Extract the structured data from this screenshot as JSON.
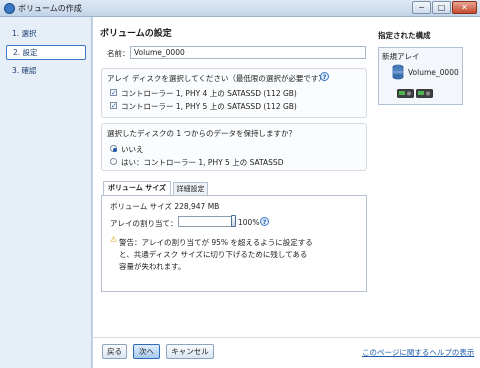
{
  "window": {
    "title": "ボリュームの作成",
    "min": "−",
    "max": "□",
    "close": "✕"
  },
  "steps": [
    {
      "label": "1. 選択"
    },
    {
      "label": "2. 設定"
    },
    {
      "label": "3. 確認"
    }
  ],
  "main": {
    "heading": "ボリュームの設定",
    "name_label": "名前：",
    "name_value": "Volume_0000",
    "disk_prompt": "アレイ ディスクを選択してください（最低限の選択が必要です）：",
    "disks": [
      {
        "label": "コントローラー 1, PHY 4 上の SATASSD (112 GB)",
        "checked": true
      },
      {
        "label": "コントローラー 1, PHY 5 上の SATASSD (112 GB)",
        "checked": true
      }
    ],
    "keep_prompt": "選択したディスクの 1 つからのデータを保持しますか？",
    "keep_options": [
      {
        "label": "いいえ",
        "selected": true
      },
      {
        "label": "はい：コントローラー 1, PHY 5 上の SATASSD",
        "selected": false
      }
    ],
    "tabs": [
      {
        "label": "ボリューム サイズ"
      },
      {
        "label": "詳細設定"
      }
    ],
    "volume_size": "ボリューム サイズ 228,947 MB",
    "alloc_label": "アレイの割り当て：",
    "alloc_percent": "100%",
    "alloc_value": 1.0,
    "warning_lines": [
      "警告：アレイの割り当てが 95% を超えるように設定する",
      "と、共通ディスク サイズに切り下げるために残してある",
      "容量が失われます。"
    ]
  },
  "side": {
    "heading": "指定された構成",
    "array_label": "新規アレイ",
    "volume_label": "Volume_0000"
  },
  "footer": {
    "back": "戻る",
    "next": "次へ",
    "cancel": "キャンセル",
    "help_link": "このページに関するヘルプの表示"
  },
  "colors": {
    "accent": "#3a78c3",
    "link": "#1d5aa7",
    "sidebar": "#e6eef8"
  },
  "icons": {
    "app": "volume-icon",
    "help": "help-icon",
    "warning": "warning-icon",
    "disk": "disk-icon",
    "volume": "volume-stack-icon"
  }
}
